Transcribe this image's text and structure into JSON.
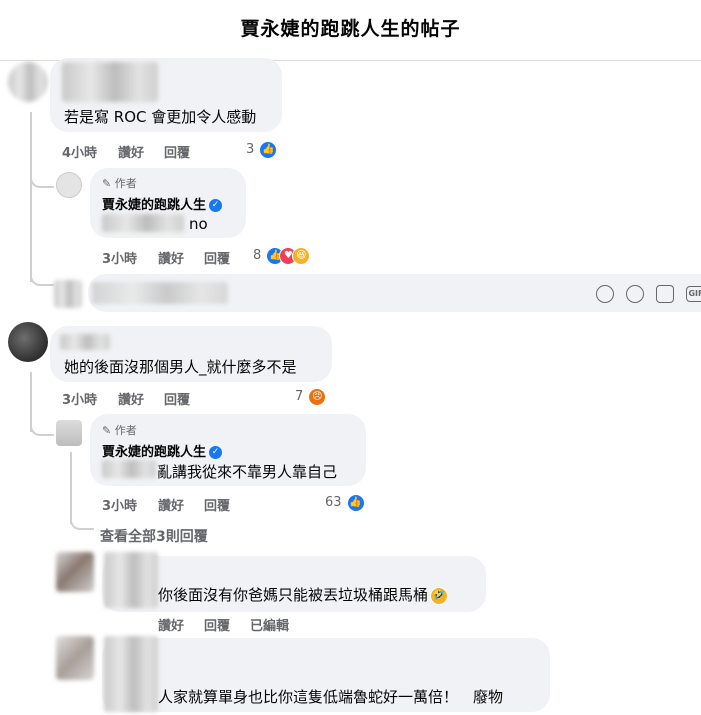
{
  "header": {
    "title": "賈永婕的跑跳人生的帖子"
  },
  "comments": [
    {
      "text": "若是寫 ROC 會更加令人感動",
      "time": "4小時",
      "like": "讚好",
      "reply": "回覆",
      "reactions": "3",
      "replies": [
        {
          "badge": "作者",
          "author": "賈永婕的跑跳人生",
          "text": "no",
          "time": "3小時",
          "like": "讚好",
          "reply": "回覆",
          "reactions": "8"
        }
      ]
    },
    {
      "text": "她的後面沒那個男人_就什麼多不是",
      "time": "3小時",
      "like": "讚好",
      "reply": "回覆",
      "reactions": "7",
      "replies": [
        {
          "badge": "作者",
          "author": "賈永婕的跑跳人生",
          "text": "亂講我從來不靠男人靠自己",
          "time": "3小時",
          "like": "讚好",
          "reply": "回覆",
          "reactions": "63"
        }
      ],
      "view_all": "查看全部3則回覆"
    },
    {
      "text": "你後面沒有你爸媽只能被丟垃圾桶跟馬桶",
      "like": "讚好",
      "reply": "回覆",
      "edited": "已編輯"
    },
    {
      "text": "人家就算單身也比你這隻低端魯蛇好一萬倍！　廢物"
    }
  ],
  "composer_icons": [
    "sticker-icon",
    "emoji-icon",
    "camera-icon",
    "gif-icon"
  ],
  "gif_label": "GIF"
}
